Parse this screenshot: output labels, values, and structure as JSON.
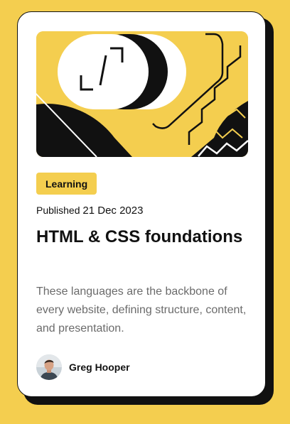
{
  "colors": {
    "background": "#F4CE4F",
    "card": "#FFFFFF",
    "ink": "#111111",
    "muted_text": "#6B6B6B"
  },
  "card": {
    "hero_image": "html-css-illustration",
    "tag": "Learning",
    "published_prefix": "Published",
    "published_date": "21 Dec 2023",
    "title": "HTML & CSS foundations",
    "description": "These languages are the backbone of every website, defining structure, content, and presentation.",
    "author": {
      "name": "Greg Hooper",
      "avatar": "avatar-greg-hooper"
    }
  }
}
